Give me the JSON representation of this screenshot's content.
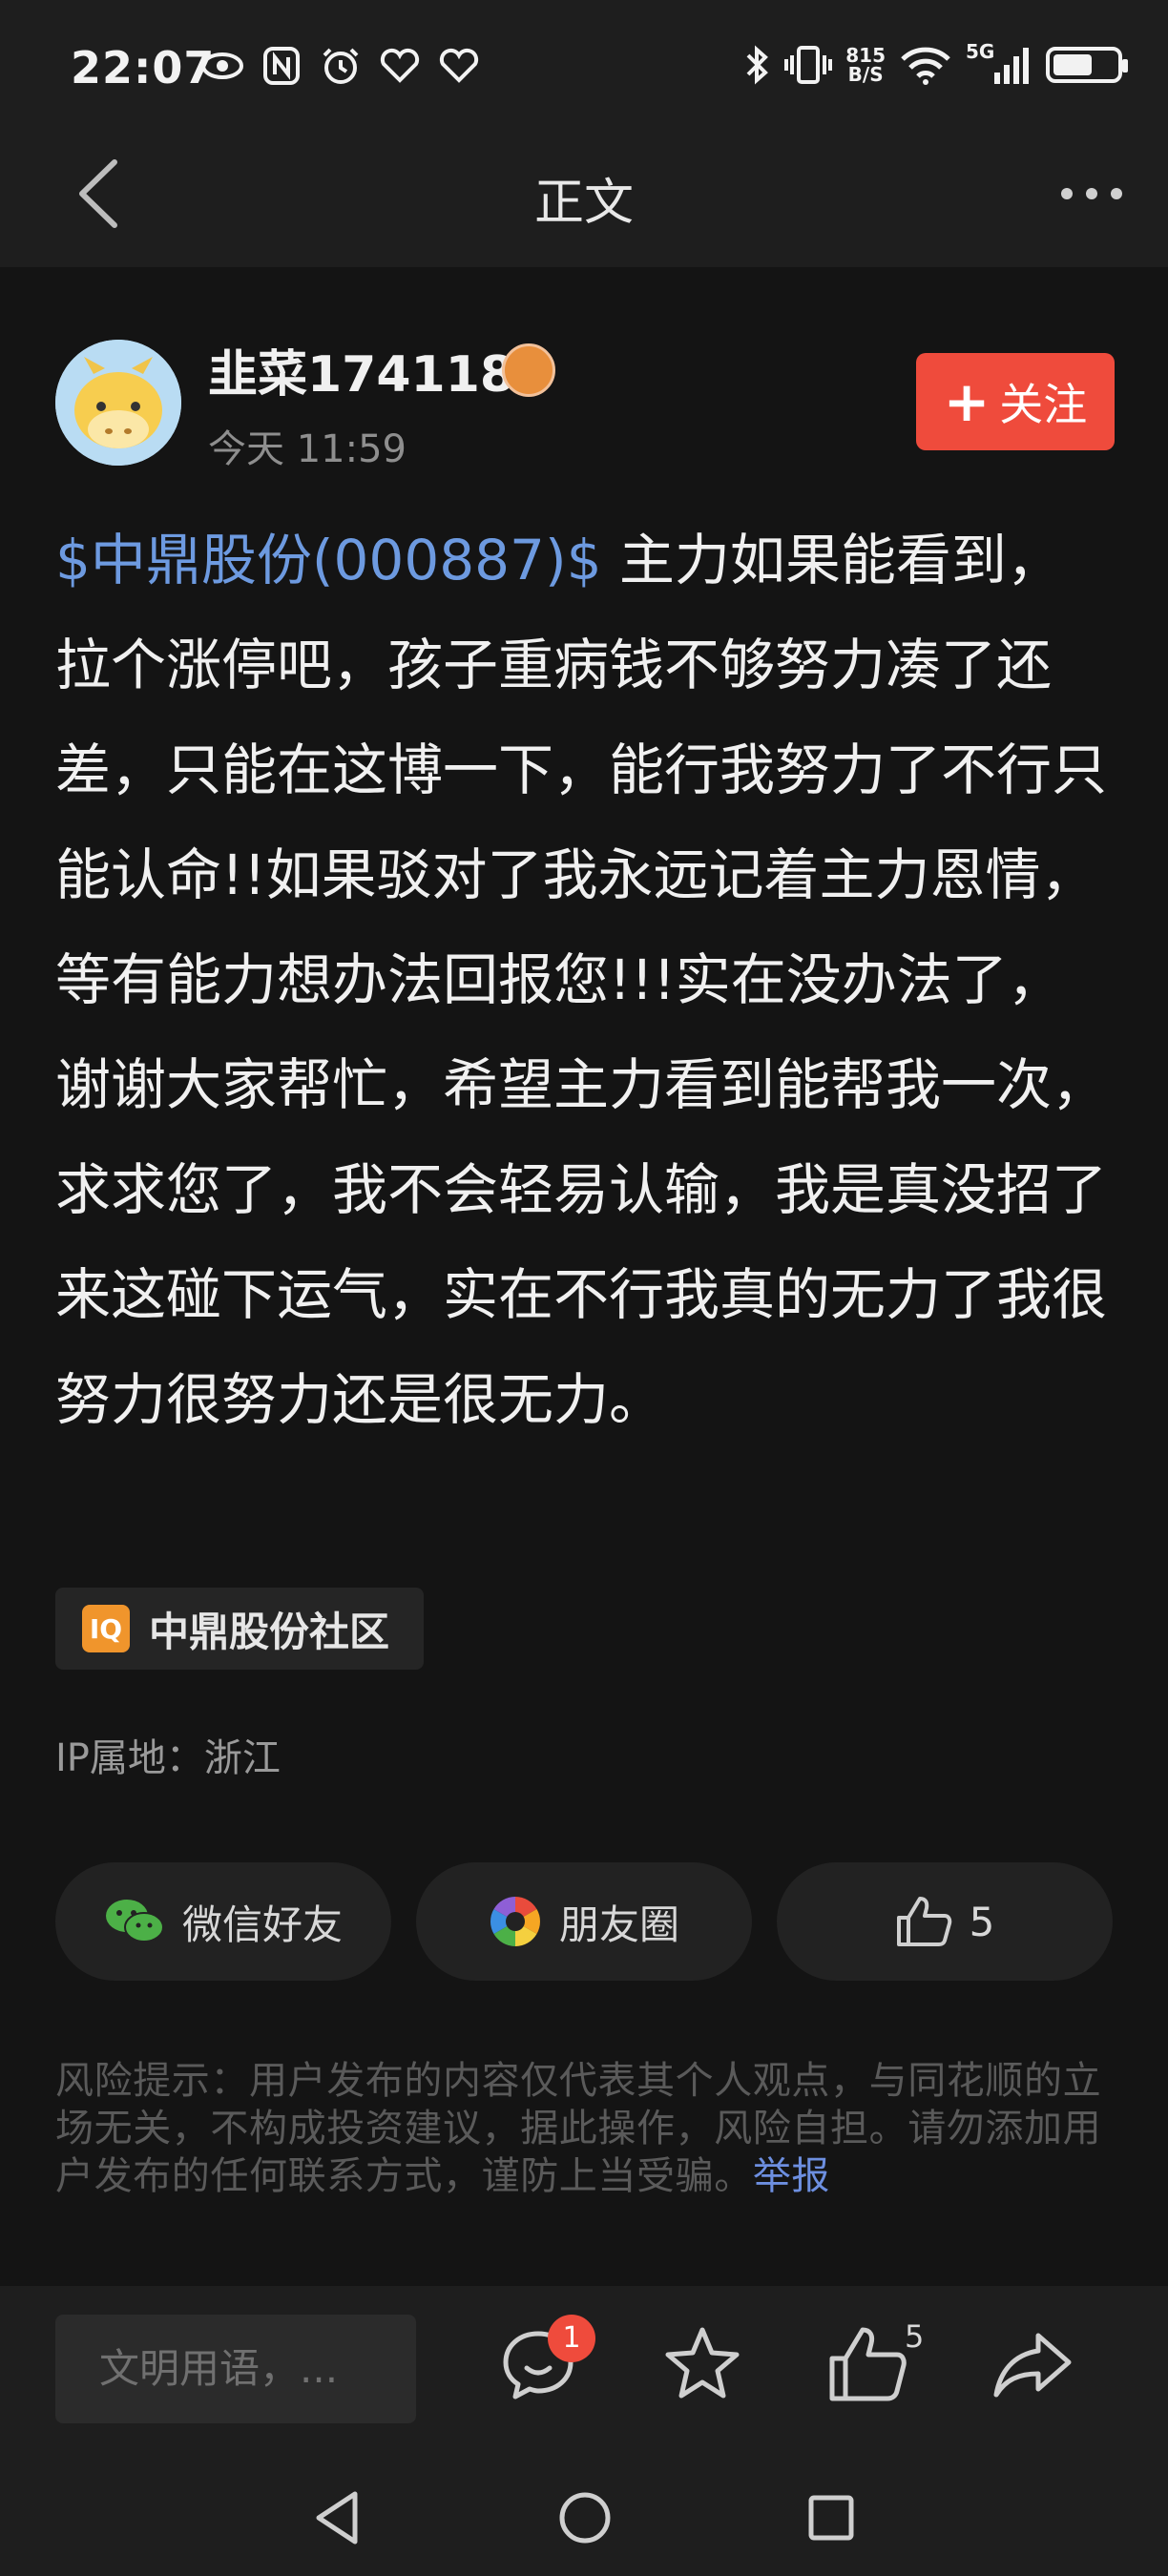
{
  "status_bar": {
    "time": "22:07",
    "net_speed_top": "815",
    "net_speed_bottom": "B/S",
    "signal": "5G"
  },
  "header": {
    "title": "正文"
  },
  "author": {
    "name": "韭菜174118",
    "time": "今天 11:59"
  },
  "follow_label": "关注",
  "post": {
    "stock_tag": "$中鼎股份(000887)$",
    "text": " 主力如果能看到，拉个涨停吧，孩子重病钱不够努力凑了还差，只能在这博一下，能行我努力了不行只能认命!!如果驳对了我永远记着主力恩情，等有能力想办法回报您!!!实在没办法了，谢谢大家帮忙，希望主力看到能帮我一次，求求您了，我不会轻易认输，我是真没招了来这碰下运气，实在不行我真的无力了我很努力很努力还是很无力。"
  },
  "community": {
    "label": "中鼎股份社区"
  },
  "ip_location": "IP属地：浙江",
  "share": {
    "wechat": "微信好友",
    "moments": "朋友圈",
    "like_count": "5"
  },
  "risk": {
    "text": "风险提示：用户发布的内容仅代表其个人观点，与同花顺的立场无关，不构成投资建议，据此操作，风险自担。请勿添加用户发布的任何联系方式，谨防上当受骗。",
    "report": "举报"
  },
  "bottom_bar": {
    "input_placeholder": "文明用语，...",
    "comment_count": "1",
    "like_count": "5"
  }
}
